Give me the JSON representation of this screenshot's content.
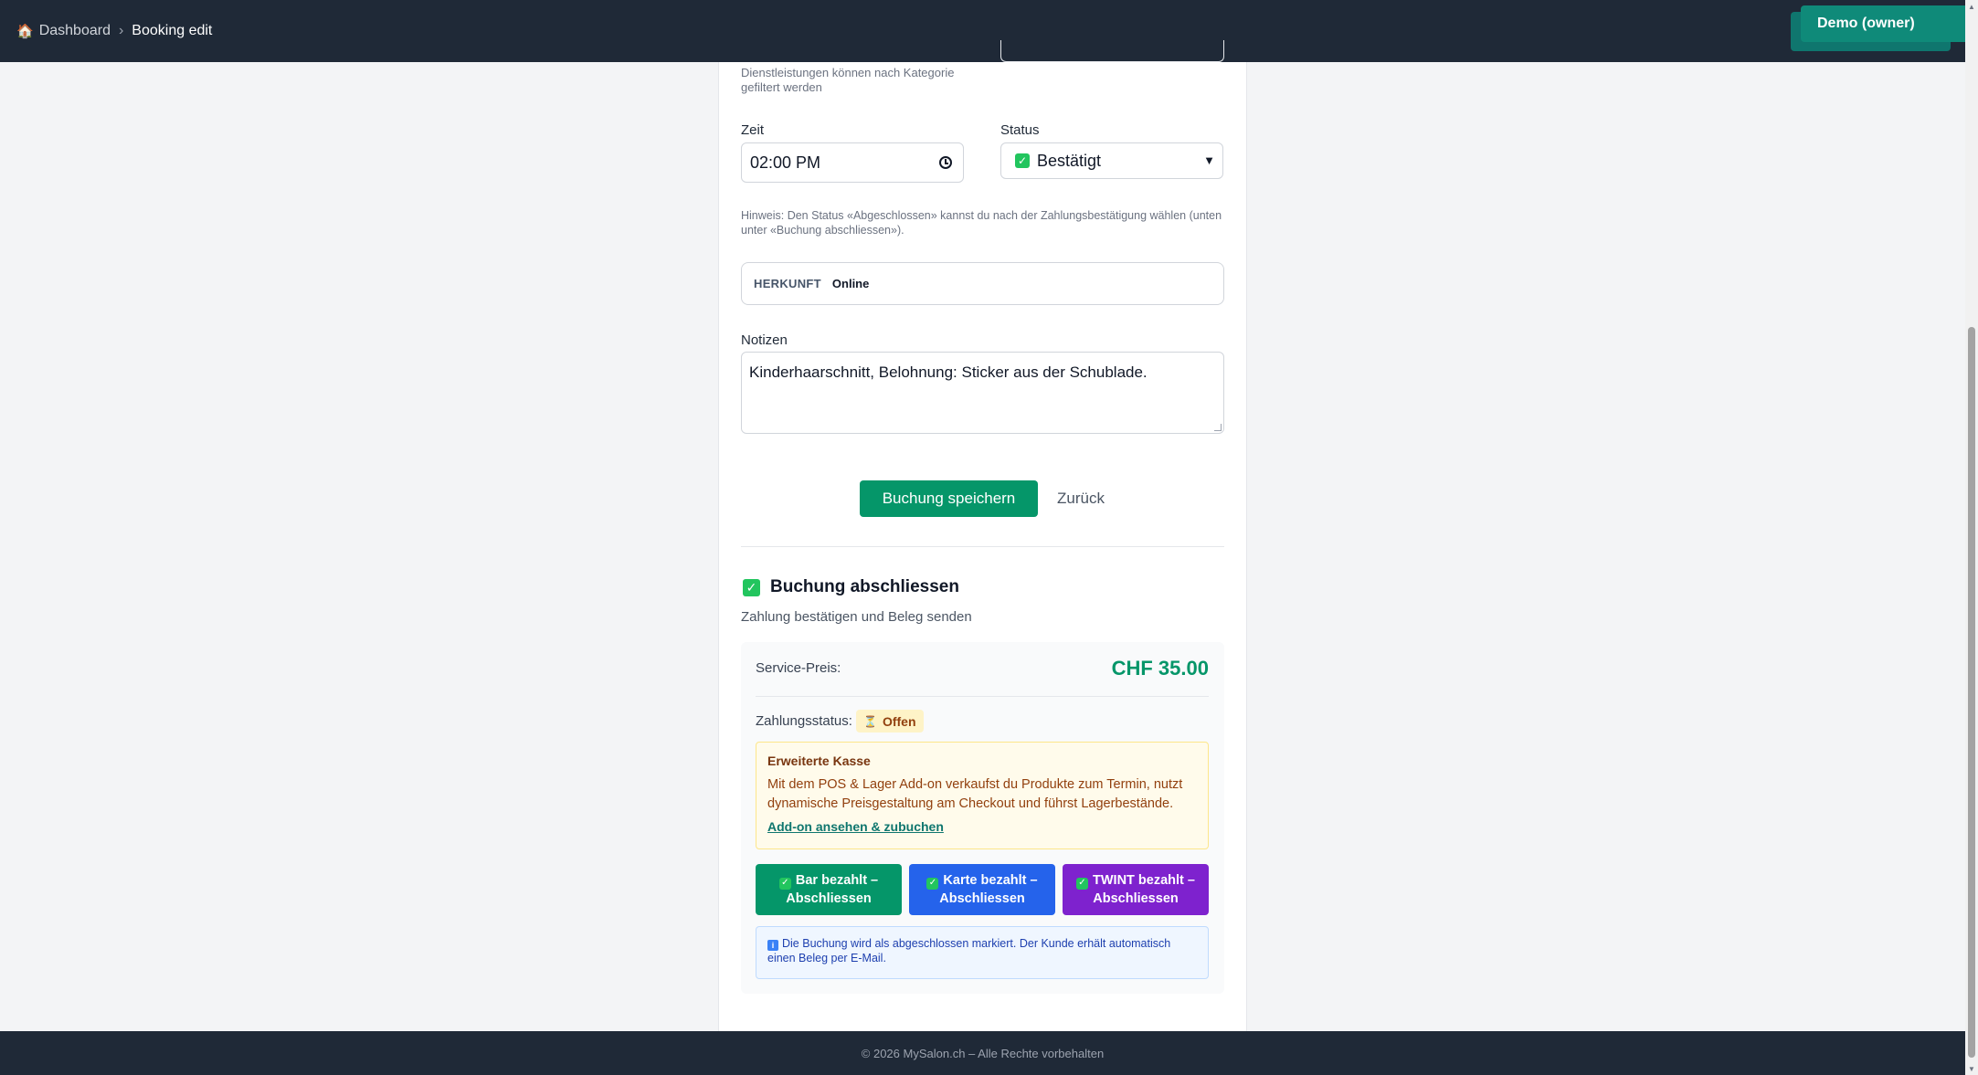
{
  "breadcrumb": {
    "home": "Dashboard",
    "separator": "›",
    "current": "Booking edit"
  },
  "user": {
    "label": "Demo (owner)"
  },
  "form": {
    "category_hint": "Dienstleistungen können nach Kategorie gefiltert werden",
    "time": {
      "label": "Zeit",
      "value": "02:00 PM"
    },
    "status": {
      "label": "Status",
      "value": "Bestätigt"
    },
    "status_hint": "Hinweis: Den Status «Abgeschlossen» kannst du nach der Zahlungsbestätigung wählen (unten unter «Buchung abschliessen»).",
    "origin": {
      "key": "HERKUNFT",
      "value": "Online"
    },
    "notes": {
      "label": "Notizen",
      "value": "Kinderhaarschnitt, Belohnung: Sticker aus der Schublade."
    },
    "save_label": "Buchung speichern",
    "back_label": "Zurück"
  },
  "complete": {
    "title": "Buchung abschliessen",
    "subtitle": "Zahlung bestätigen und Beleg senden",
    "price_label": "Service-Preis:",
    "price_value": "CHF 35.00",
    "payment_status_label": "Zahlungsstatus:",
    "payment_status_value": "Offen",
    "addon": {
      "title": "Erweiterte Kasse",
      "text": "Mit dem POS & Lager Add-on verkaufst du Produkte zum Termin, nutzt dynamische Preisgestaltung am Checkout und führst Lagerbestände.",
      "link": "Add-on ansehen & zubuchen"
    },
    "buttons": {
      "cash": "Bar bezahlt – Abschliessen",
      "card": "Karte bezahlt – Abschliessen",
      "twint": "TWINT bezahlt – Abschliessen"
    },
    "info": "Die Buchung wird als abgeschlossen markiert. Der Kunde erhält automatisch einen Beleg per E-Mail."
  },
  "footer": {
    "text": "© 2026 MySalon.ch – Alle Rechte vorbehalten"
  },
  "colors": {
    "primary": "#059669",
    "card_btn": "#2563eb",
    "twint_btn": "#7e22ce",
    "nav": "#1f2937"
  }
}
